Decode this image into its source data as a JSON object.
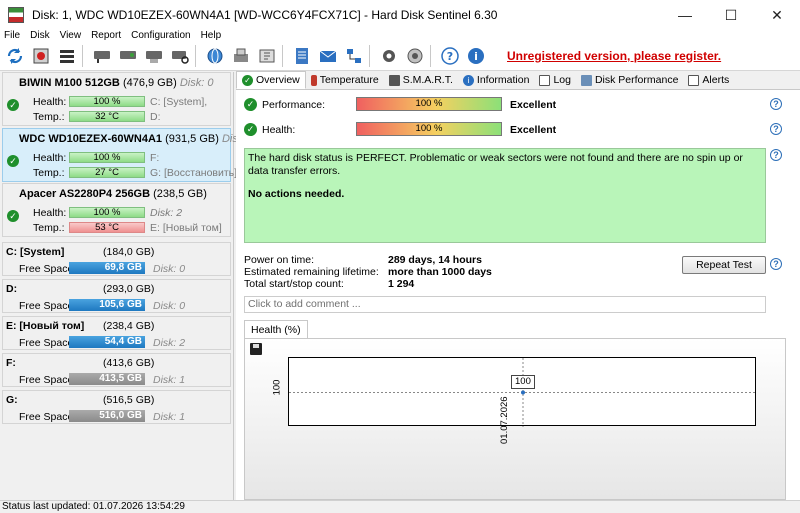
{
  "window": {
    "title": "Disk: 1, WDC WD10EZEX-60WN4A1 [WD-WCC6Y4FCX71C]  -  Hard Disk Sentinel 6.30",
    "controls": [
      "—",
      "☐",
      "✕"
    ]
  },
  "menu": [
    "File",
    "Disk",
    "View",
    "Report",
    "Configuration",
    "Help"
  ],
  "toolbar": {
    "register_text": "Unregistered version, please register."
  },
  "disks": [
    {
      "name": "BIWIN M100 512GB",
      "size": "(476,9 GB)",
      "index": "Disk: 0",
      "health_label": "Health:",
      "health": "100 %",
      "health_pct": 100,
      "health_extra": "C: [System],",
      "temp_label": "Temp.:",
      "temp": "32 °C",
      "temp_extra": "D:"
    },
    {
      "name": "WDC WD10EZEX-60WN4A1",
      "size": "(931,5 GB)",
      "index": "Disk: 1",
      "health_label": "Health:",
      "health": "100 %",
      "health_pct": 100,
      "health_extra": "F:",
      "temp_label": "Temp.:",
      "temp": "27 °C",
      "temp_extra": "G: [Восстановить]"
    },
    {
      "name": "Apacer AS2280P4 256GB",
      "size": "(238,5 GB)",
      "index": "",
      "health_label": "Health:",
      "health": "100 %",
      "health_pct": 100,
      "health_extra": "Disk: 2",
      "temp_label": "Temp.:",
      "temp": "53 °C",
      "temp_extra": "E: [Новый том]"
    }
  ],
  "volumes": [
    {
      "name": "C: [System]",
      "size": "(184,0 GB)",
      "free_label": "Free Space",
      "free": "69,8 GB",
      "disk": "Disk: 0",
      "color": "#1e78c0"
    },
    {
      "name": "D:",
      "size": "(293,0 GB)",
      "free_label": "Free Space",
      "free": "105,6 GB",
      "disk": "Disk: 0",
      "color": "#1e78c0"
    },
    {
      "name": "E: [Новый том]",
      "size": "(238,4 GB)",
      "free_label": "Free Space",
      "free": "54,4 GB",
      "disk": "Disk: 2",
      "color": "#1e78c0"
    },
    {
      "name": "F:",
      "size": "(413,6 GB)",
      "free_label": "Free Space",
      "free": "413,5 GB",
      "disk": "Disk: 1",
      "color": "#8a8a8a"
    },
    {
      "name": "G:",
      "size": "(516,5 GB)",
      "free_label": "Free Space",
      "free": "516,0 GB",
      "disk": "Disk: 1",
      "color": "#8a8a8a"
    }
  ],
  "tabs": [
    "Overview",
    "Temperature",
    "S.M.A.R.T.",
    "Information",
    "Log",
    "Disk Performance",
    "Alerts"
  ],
  "overview": {
    "performance_label": "Performance:",
    "performance": "100 %",
    "performance_pct": 100,
    "performance_rating": "Excellent",
    "health_label": "Health:",
    "health": "100 %",
    "health_pct": 100,
    "health_rating": "Excellent",
    "status_text": "The hard disk status is PERFECT. Problematic or weak sectors were not found and there are no spin up or data transfer errors.",
    "status_action": "No actions needed.",
    "power_on_label": "Power on time:",
    "power_on": "289 days, 14 hours",
    "lifetime_label": "Estimated remaining lifetime:",
    "lifetime": "more than 1000 days",
    "startstop_label": "Total start/stop count:",
    "startstop": "1 294",
    "repeat_button": "Repeat Test",
    "comment_placeholder": "Click to add comment ..."
  },
  "chart_data": {
    "type": "line",
    "title": "Health (%)",
    "x": [
      "01.07.2026"
    ],
    "series": [
      {
        "values": [
          100
        ]
      }
    ],
    "y_ticks": [
      "100"
    ],
    "data_labels": [
      "100"
    ]
  },
  "statusbar": {
    "text": "Status last updated: 01.07.2026 13:54:29"
  }
}
